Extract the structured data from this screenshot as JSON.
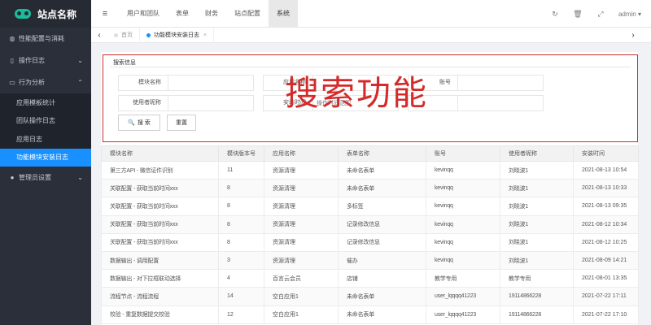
{
  "app": {
    "title": "站点名称"
  },
  "sidebar": {
    "items": [
      {
        "label": "性能配置与消耗",
        "icon": "shield-icon",
        "glyph": "◍"
      },
      {
        "label": "操作日志",
        "icon": "book-icon",
        "glyph": "▯",
        "chevron": "⌄"
      },
      {
        "label": "行为分析",
        "icon": "monitor-icon",
        "glyph": "▭",
        "chevron": "⌃"
      },
      {
        "label": "管理员设置",
        "icon": "user-icon",
        "glyph": "●",
        "chevron": "⌄"
      }
    ],
    "subitems": [
      {
        "label": "应用模板统计"
      },
      {
        "label": "团队操作日志"
      },
      {
        "label": "应用日志"
      },
      {
        "label": "功能模块安装日志",
        "active": true
      }
    ]
  },
  "topbar": {
    "menu_icon": "≡",
    "nav": [
      "用户和团队",
      "表单",
      "财务",
      "站点配置",
      "系统"
    ],
    "active_nav": "系统",
    "icons": [
      {
        "name": "refresh-icon",
        "glyph": "↻"
      },
      {
        "name": "trash-icon",
        "glyph": "🗑"
      },
      {
        "name": "fullscreen-icon",
        "glyph": "⤢"
      }
    ],
    "user": "admin ▾"
  },
  "tabs": {
    "left_arrow": "‹",
    "right_arrow": "›",
    "items": [
      {
        "label": "首页",
        "active": false
      },
      {
        "label": "功能模块安装日志",
        "active": true,
        "close": "×"
      }
    ]
  },
  "search": {
    "title": "搜索信息",
    "fields": [
      {
        "label": "模块名称",
        "value": ""
      },
      {
        "label": "应用名称",
        "value": ""
      },
      {
        "label": "账号",
        "value": ""
      },
      {
        "label": "使用者昵称",
        "value": ""
      },
      {
        "label": "安装时间",
        "value": ""
      },
      {
        "label": "",
        "value": ""
      }
    ],
    "range_placeholder": "操作时间范围",
    "search_button": "搜 索",
    "search_icon": "🔍",
    "reset_button": "重置",
    "overlay_text": "搜索功能"
  },
  "table": {
    "columns": [
      "模块名称",
      "模块版本号",
      "应用名称",
      "表单名称",
      "账号",
      "使用者昵称",
      "安装时间"
    ],
    "rows": [
      [
        "第三方API - 微信证件识别",
        "11",
        "资源清理",
        "未命名表单",
        "kevinqq",
        "刘晓波1",
        "2021-08-13 10:54"
      ],
      [
        "关联配置 - 获取当前时间xxx",
        "8",
        "资源清理",
        "未命名表单",
        "kevinqq",
        "刘晓波1",
        "2021-08-13 10:33"
      ],
      [
        "关联配置 - 获取当前时间xxx",
        "8",
        "资源清理",
        "多标签",
        "kevinqq",
        "刘晓波1",
        "2021-08-13 09:35"
      ],
      [
        "关联配置 - 获取当前时间xxx",
        "8",
        "资源清理",
        "记录修改信息",
        "kevinqq",
        "刘晓波1",
        "2021-08-12 10:34"
      ],
      [
        "关联配置 - 获取当前时间xxx",
        "8",
        "资源清理",
        "记录修改信息",
        "kevinqq",
        "刘晓波1",
        "2021-08-12 10:25"
      ],
      [
        "数据输出 - 调用配置",
        "3",
        "资源清理",
        "催办",
        "kevinqq",
        "刘晓波1",
        "2021-08-09 14:21"
      ],
      [
        "数据输出 - 对下拉框联动选择",
        "4",
        "百言云会员",
        "店铺",
        "教学专用",
        "教学专用",
        "2021-08-01 13:35"
      ],
      [
        "流程节点 - 流程流程",
        "14",
        "空白应用1",
        "未命名表单",
        "user_lqqqq41223",
        "19114866228",
        "2021-07-22 17:11"
      ],
      [
        "校验 - 重复数据提交校验",
        "12",
        "空白应用1",
        "未命名表单",
        "user_lqqqq41223",
        "19114866228",
        "2021-07-22 17:10"
      ]
    ]
  }
}
